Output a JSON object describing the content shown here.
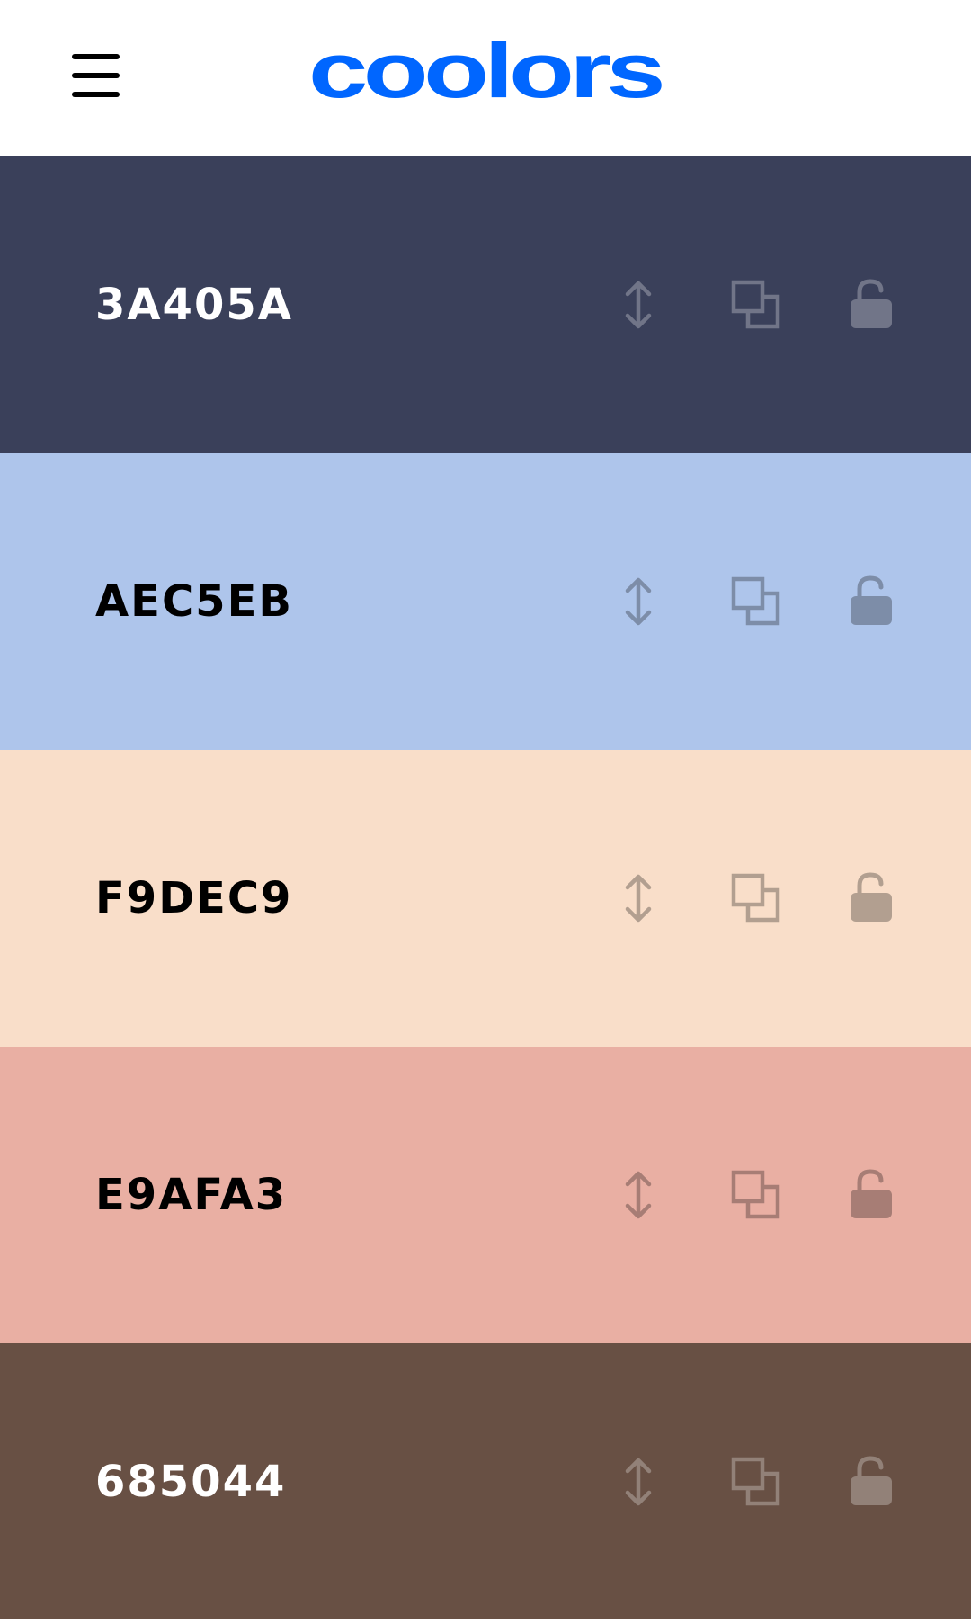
{
  "header": {
    "logo_text": "coolors",
    "logo_color": "#0066ff",
    "menu_icon": "hamburger-menu-icon"
  },
  "swatches": [
    {
      "hex": "3A405A",
      "bg": "#3a405a",
      "text_color": "#ffffff",
      "icon_color": "#ffffff"
    },
    {
      "hex": "AEC5EB",
      "bg": "#aec5eb",
      "text_color": "#000000",
      "icon_color": "#000000"
    },
    {
      "hex": "F9DEC9",
      "bg": "#f9dec9",
      "text_color": "#000000",
      "icon_color": "#000000"
    },
    {
      "hex": "E9AFA3",
      "bg": "#e9afa3",
      "text_color": "#000000",
      "icon_color": "#000000"
    },
    {
      "hex": "685044",
      "bg": "#685044",
      "text_color": "#ffffff",
      "icon_color": "#ffffff"
    }
  ],
  "icons": {
    "drag": "drag-handle-icon",
    "copy": "copy-icon",
    "lock": "unlocked-icon"
  }
}
